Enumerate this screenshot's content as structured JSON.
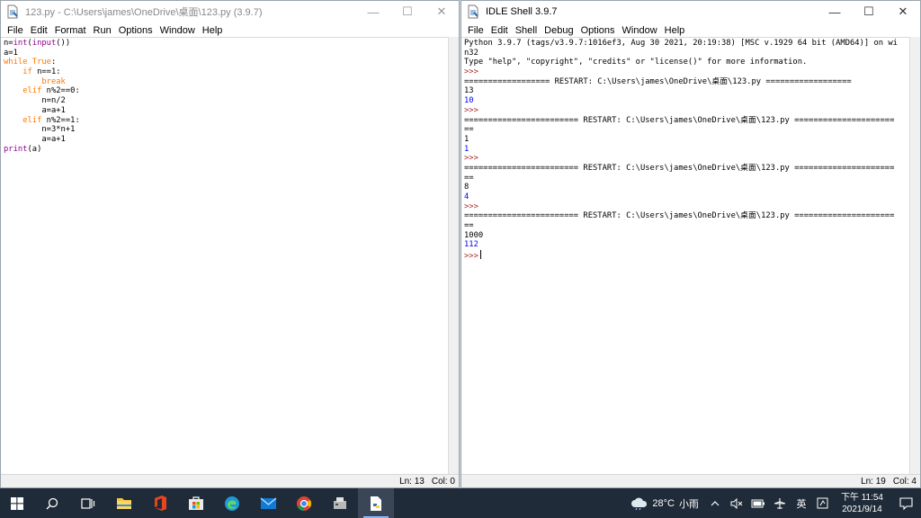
{
  "editor_window": {
    "title": "123.py - C:\\Users\\james\\OneDrive\\桌面\\123.py (3.9.7)",
    "menu": [
      "File",
      "Edit",
      "Format",
      "Run",
      "Options",
      "Window",
      "Help"
    ],
    "code_lines": [
      [
        {
          "t": "n=",
          "c": "norm"
        },
        {
          "t": "int",
          "c": "bi"
        },
        {
          "t": "(",
          "c": "norm"
        },
        {
          "t": "input",
          "c": "bi"
        },
        {
          "t": "())",
          "c": "norm"
        }
      ],
      [
        {
          "t": "a=1",
          "c": "norm"
        }
      ],
      [
        {
          "t": "while",
          "c": "kw"
        },
        {
          "t": " ",
          "c": "norm"
        },
        {
          "t": "True",
          "c": "kw"
        },
        {
          "t": ":",
          "c": "norm"
        }
      ],
      [
        {
          "t": "    ",
          "c": "norm"
        },
        {
          "t": "if",
          "c": "kw"
        },
        {
          "t": " n==1:",
          "c": "norm"
        }
      ],
      [
        {
          "t": "        ",
          "c": "norm"
        },
        {
          "t": "break",
          "c": "kw"
        }
      ],
      [
        {
          "t": "    ",
          "c": "norm"
        },
        {
          "t": "elif",
          "c": "kw"
        },
        {
          "t": " n%2==0:",
          "c": "norm"
        }
      ],
      [
        {
          "t": "        n=n/2",
          "c": "norm"
        }
      ],
      [
        {
          "t": "        a=a+1",
          "c": "norm"
        }
      ],
      [
        {
          "t": "    ",
          "c": "norm"
        },
        {
          "t": "elif",
          "c": "kw"
        },
        {
          "t": " n%2==1:",
          "c": "norm"
        }
      ],
      [
        {
          "t": "        n=3*n+1",
          "c": "norm"
        }
      ],
      [
        {
          "t": "        a=a+1",
          "c": "norm"
        }
      ],
      [
        {
          "t": "print",
          "c": "bi"
        },
        {
          "t": "(a)",
          "c": "norm"
        }
      ]
    ],
    "status": {
      "ln": "Ln: 13",
      "col": "Col: 0"
    }
  },
  "shell_window": {
    "title": "IDLE Shell 3.9.7",
    "menu": [
      "File",
      "Edit",
      "Shell",
      "Debug",
      "Options",
      "Window",
      "Help"
    ],
    "lines": [
      {
        "t": "Python 3.9.7 (tags/v3.9.7:1016ef3, Aug 30 2021, 20:19:38) [MSC v.1929 64 bit (AMD64)] on wi",
        "c": "norm"
      },
      {
        "t": "n32",
        "c": "norm"
      },
      {
        "t": "Type \"help\", \"copyright\", \"credits\" or \"license()\" for more information.",
        "c": "norm"
      },
      {
        "t": ">>>",
        "c": "prompt"
      },
      {
        "t": "================== RESTART: C:\\Users\\james\\OneDrive\\桌面\\123.py ==================",
        "c": "norm"
      },
      {
        "t": "13",
        "c": "norm"
      },
      {
        "t": "10",
        "c": "out"
      },
      {
        "t": ">>>",
        "c": "prompt"
      },
      {
        "t": "======================== RESTART: C:\\Users\\james\\OneDrive\\桌面\\123.py =====================",
        "c": "norm"
      },
      {
        "t": "==",
        "c": "norm"
      },
      {
        "t": "1",
        "c": "norm"
      },
      {
        "t": "1",
        "c": "out"
      },
      {
        "t": ">>>",
        "c": "prompt"
      },
      {
        "t": "======================== RESTART: C:\\Users\\james\\OneDrive\\桌面\\123.py =====================",
        "c": "norm"
      },
      {
        "t": "==",
        "c": "norm"
      },
      {
        "t": "8",
        "c": "norm"
      },
      {
        "t": "4",
        "c": "out"
      },
      {
        "t": ">>>",
        "c": "prompt"
      },
      {
        "t": "======================== RESTART: C:\\Users\\james\\OneDrive\\桌面\\123.py =====================",
        "c": "norm"
      },
      {
        "t": "==",
        "c": "norm"
      },
      {
        "t": "1000",
        "c": "norm"
      },
      {
        "t": "112",
        "c": "out"
      }
    ],
    "final_prompt": ">>>",
    "status": {
      "ln": "Ln: 19",
      "col": "Col: 4"
    }
  },
  "window_controls": {
    "minimize": "—",
    "maximize": "☐",
    "close": "✕"
  },
  "taskbar": {
    "weather": {
      "temp": "28°C",
      "desc": "小雨"
    },
    "ime": "英",
    "clock": {
      "time": "下午 11:54",
      "date": "2021/9/14"
    }
  },
  "colors": {
    "keyword": "#ff7700",
    "builtin": "#900090",
    "output": "#0000ff",
    "prompt": "#a52a2a",
    "taskbar": "#1f2b38"
  }
}
